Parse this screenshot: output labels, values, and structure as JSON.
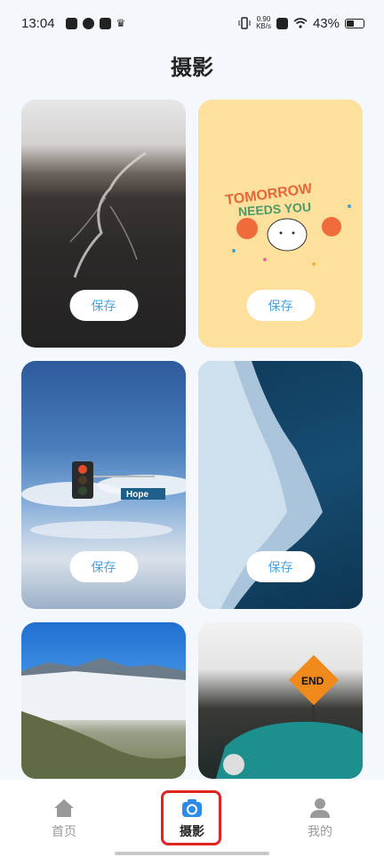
{
  "status_bar": {
    "time": "13:04",
    "net_speed_value": "0.90",
    "net_speed_unit": "KB/s",
    "battery": "43%"
  },
  "page": {
    "title": "摄影"
  },
  "cards": [
    {
      "save_label": "保存",
      "image": "river-delta-aerial"
    },
    {
      "save_label": "保存",
      "image": "tomorrow-needs-you-illustration",
      "text": "TOMORROW NEEDS YOU"
    },
    {
      "save_label": "保存",
      "image": "traffic-light-sky",
      "sign": "Hope"
    },
    {
      "save_label": "保存",
      "image": "iceberg-aerial"
    },
    {
      "image": "snowy-mountains"
    },
    {
      "image": "teal-car-end-sign",
      "sign": "END"
    }
  ],
  "bottom_nav": {
    "items": [
      {
        "label": "首页",
        "icon": "home-icon",
        "active": false
      },
      {
        "label": "摄影",
        "icon": "camera-icon",
        "active": true
      },
      {
        "label": "我的",
        "icon": "person-icon",
        "active": false
      }
    ]
  },
  "colors": {
    "accent": "#4aa3df",
    "highlight": "#e02424"
  }
}
